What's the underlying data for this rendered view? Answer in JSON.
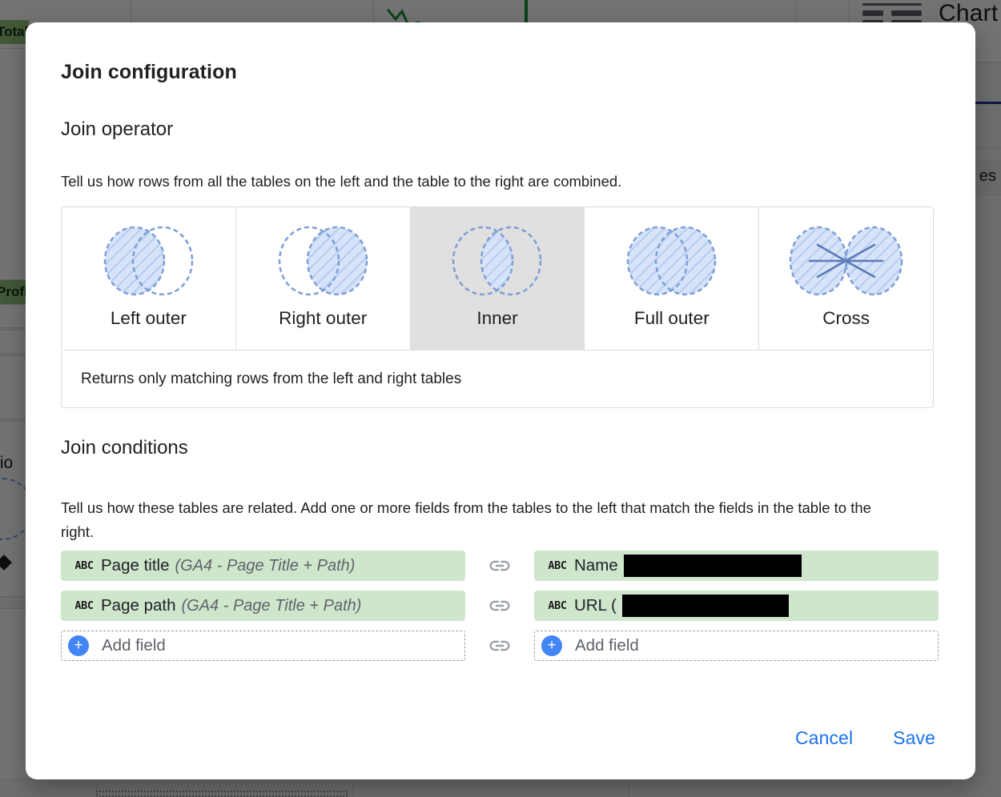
{
  "background": {
    "chart_label": "Chart",
    "cells": [
      {
        "name": "total-cell",
        "text": "Total"
      },
      {
        "name": "profit-cell",
        "text": "Profi"
      }
    ],
    "fragments": [
      {
        "name": "ratio-text-fragment",
        "text": "tio"
      },
      {
        "name": "tables-text-fragment",
        "text": "es"
      }
    ]
  },
  "dialog": {
    "title": "Join configuration",
    "operator_section": {
      "heading": "Join operator",
      "description": "Tell us how rows from all the tables on the left and the table to the right are combined.",
      "options": [
        {
          "id": "left-outer",
          "label": "Left outer",
          "selected": false
        },
        {
          "id": "right-outer",
          "label": "Right outer",
          "selected": false
        },
        {
          "id": "inner",
          "label": "Inner",
          "selected": true
        },
        {
          "id": "full-outer",
          "label": "Full outer",
          "selected": false
        },
        {
          "id": "cross",
          "label": "Cross",
          "selected": false
        }
      ],
      "selected_description": "Returns only matching rows from the left and right tables"
    },
    "conditions_section": {
      "heading": "Join conditions",
      "description": "Tell us how these tables are related. Add one or more fields from the tables to the left that match the fields in the table to the right.",
      "link_icon": "link-icon",
      "rows": [
        {
          "left": {
            "type_icon": "ABC",
            "name": "Page title",
            "source": "(GA4 - Page Title + Path)",
            "redacted": false,
            "redaction_width": 0
          },
          "right": {
            "type_icon": "ABC",
            "name": "Name",
            "source": "",
            "redacted": true,
            "redaction_width": 222
          }
        },
        {
          "left": {
            "type_icon": "ABC",
            "name": "Page path",
            "source": "(GA4 - Page Title + Path)",
            "redacted": false,
            "redaction_width": 0
          },
          "right": {
            "type_icon": "ABC",
            "name": "URL (",
            "source": "",
            "redacted": true,
            "redaction_width": 208
          }
        }
      ],
      "add_field_left_label": "Add field",
      "add_field_right_label": "Add field",
      "add_icon": "+"
    },
    "actions": {
      "cancel_label": "Cancel",
      "save_label": "Save"
    }
  },
  "colors": {
    "accent_blue": "#1a73e8",
    "plus_blue": "#4285f4",
    "chip_green": "#cfe6cd",
    "venn_fill": "#c6d9f7",
    "venn_stroke": "#7e9fd6",
    "selected_tile": "#e0e0e0"
  }
}
